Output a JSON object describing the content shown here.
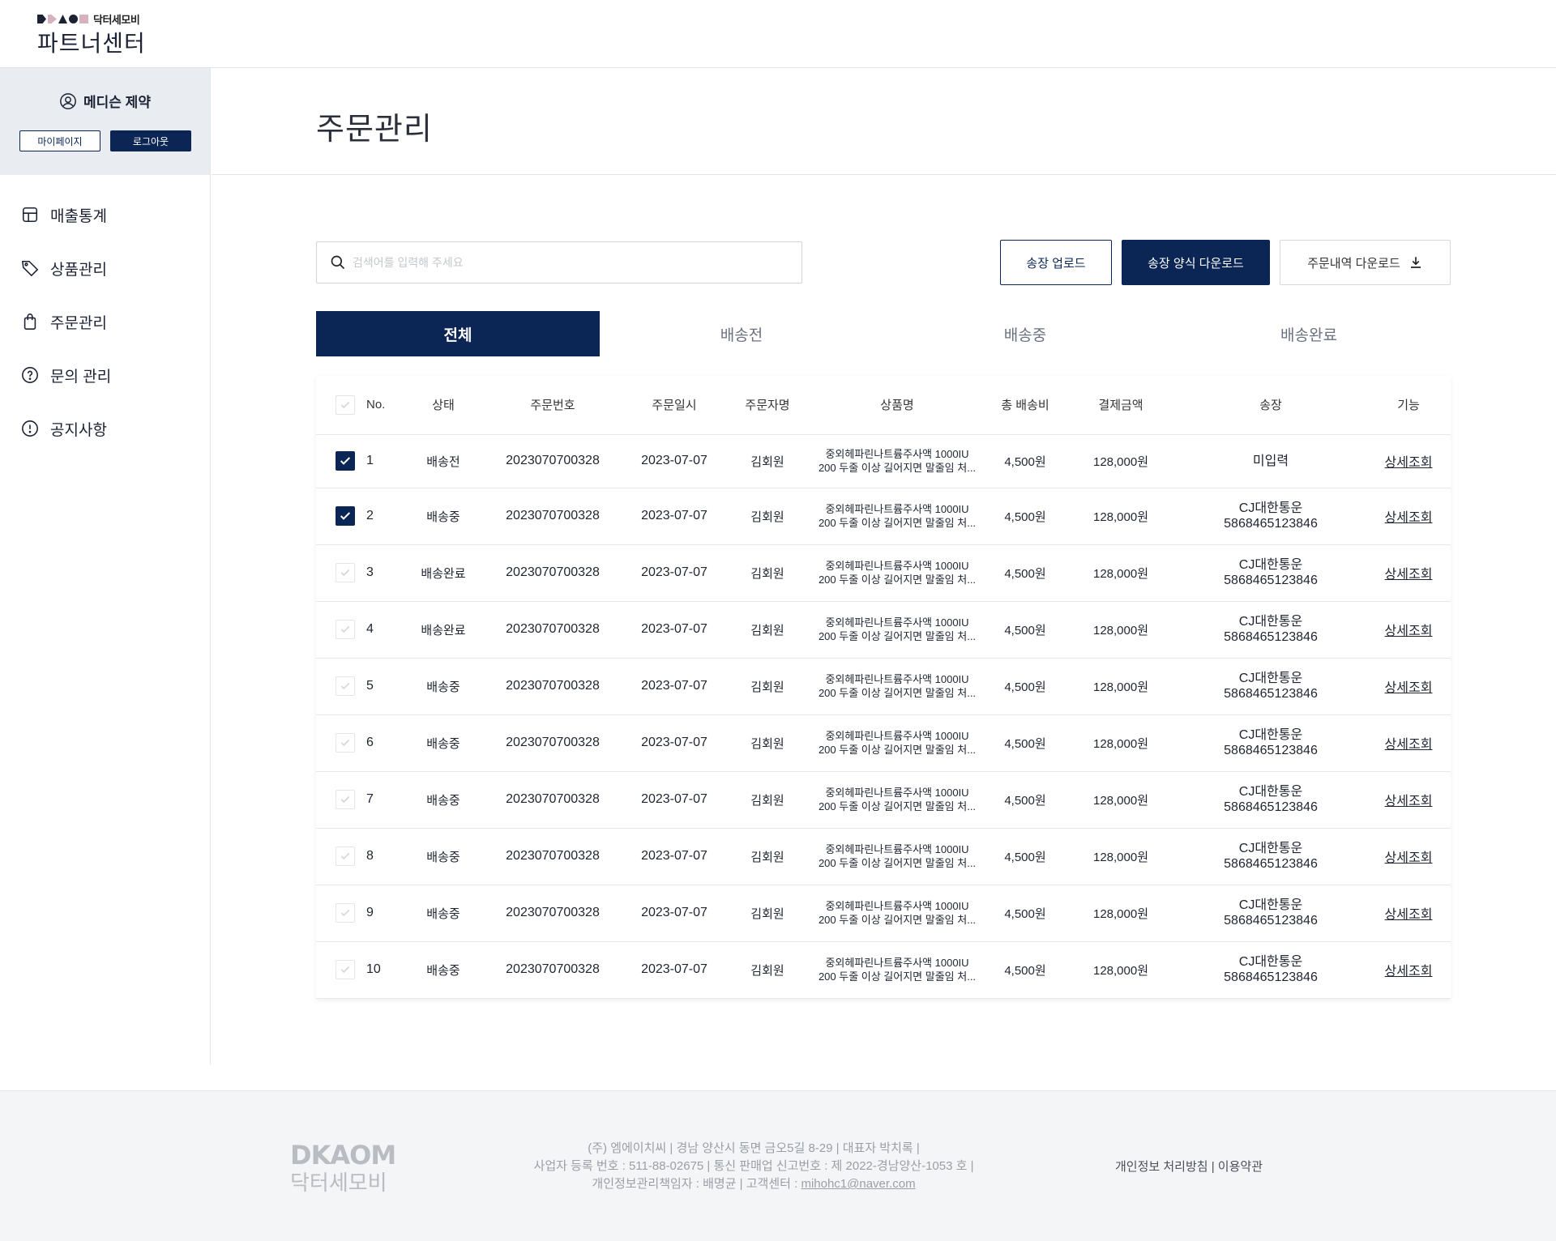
{
  "header": {
    "brand_text": "닥터세모비",
    "app_title": "파트너센터",
    "logo_marks_colors": [
      "#1c2233",
      "#d6b1c0",
      "#1c2233",
      "#d6b1c0"
    ]
  },
  "sidebar": {
    "user_name": "메디슨 제약",
    "mypage_label": "마이페이지",
    "logout_label": "로그아웃",
    "items": [
      {
        "label": "매출통계",
        "icon": "chart-icon"
      },
      {
        "label": "상품관리",
        "icon": "tag-icon"
      },
      {
        "label": "주문관리",
        "icon": "shopping-bag-icon"
      },
      {
        "label": "문의 관리",
        "icon": "question-icon"
      },
      {
        "label": "공지사항",
        "icon": "alert-icon"
      }
    ]
  },
  "main": {
    "title": "주문관리",
    "search_placeholder": "검색어를 입력해 주세요",
    "buttons": {
      "upload": "송장 업로드",
      "template": "송장 양식 다운로드",
      "history": "주문내역 다운로드"
    },
    "tabs": [
      "전체",
      "배송전",
      "배송중",
      "배송완료"
    ],
    "active_tab": "전체"
  },
  "table": {
    "headers": [
      "No.",
      "상태",
      "주문번호",
      "주문일시",
      "주문자명",
      "상품명",
      "총 배송비",
      "결제금액",
      "송장",
      "기능"
    ],
    "rows": [
      {
        "no": "1",
        "checked": true,
        "status": "배송전",
        "order_no": "2023070700328",
        "date": "2023-07-07",
        "name": "김회원",
        "product_1": "중외헤파린나트륨주사액 1000IU",
        "product_2": "200 두줄 이상 길어지면 말줄임 처...",
        "shipping": "4,500원",
        "amount": "128,000원",
        "inv_1": "미입력",
        "inv_2": "",
        "action": "상세조회"
      },
      {
        "no": "2",
        "checked": true,
        "status": "배송중",
        "order_no": "2023070700328",
        "date": "2023-07-07",
        "name": "김회원",
        "product_1": "중외헤파린나트륨주사액 1000IU",
        "product_2": "200 두줄 이상 길어지면 말줄임 처...",
        "shipping": "4,500원",
        "amount": "128,000원",
        "inv_1": "CJ대한통운",
        "inv_2": "5868465123846",
        "action": "상세조회"
      },
      {
        "no": "3",
        "checked": false,
        "status": "배송완료",
        "order_no": "2023070700328",
        "date": "2023-07-07",
        "name": "김회원",
        "product_1": "중외헤파린나트륨주사액 1000IU",
        "product_2": "200 두줄 이상 길어지면 말줄임 처...",
        "shipping": "4,500원",
        "amount": "128,000원",
        "inv_1": "CJ대한통운",
        "inv_2": "5868465123846",
        "action": "상세조회"
      },
      {
        "no": "4",
        "checked": false,
        "status": "배송완료",
        "order_no": "2023070700328",
        "date": "2023-07-07",
        "name": "김회원",
        "product_1": "중외헤파린나트륨주사액 1000IU",
        "product_2": "200 두줄 이상 길어지면 말줄임 처...",
        "shipping": "4,500원",
        "amount": "128,000원",
        "inv_1": "CJ대한통운",
        "inv_2": "5868465123846",
        "action": "상세조회"
      },
      {
        "no": "5",
        "checked": false,
        "status": "배송중",
        "order_no": "2023070700328",
        "date": "2023-07-07",
        "name": "김회원",
        "product_1": "중외헤파린나트륨주사액 1000IU",
        "product_2": "200 두줄 이상 길어지면 말줄임 처...",
        "shipping": "4,500원",
        "amount": "128,000원",
        "inv_1": "CJ대한통운",
        "inv_2": "5868465123846",
        "action": "상세조회"
      },
      {
        "no": "6",
        "checked": false,
        "status": "배송중",
        "order_no": "2023070700328",
        "date": "2023-07-07",
        "name": "김회원",
        "product_1": "중외헤파린나트륨주사액 1000IU",
        "product_2": "200 두줄 이상 길어지면 말줄임 처...",
        "shipping": "4,500원",
        "amount": "128,000원",
        "inv_1": "CJ대한통운",
        "inv_2": "5868465123846",
        "action": "상세조회"
      },
      {
        "no": "7",
        "checked": false,
        "status": "배송중",
        "order_no": "2023070700328",
        "date": "2023-07-07",
        "name": "김회원",
        "product_1": "중외헤파린나트륨주사액 1000IU",
        "product_2": "200 두줄 이상 길어지면 말줄임 처...",
        "shipping": "4,500원",
        "amount": "128,000원",
        "inv_1": "CJ대한통운",
        "inv_2": "5868465123846",
        "action": "상세조회"
      },
      {
        "no": "8",
        "checked": false,
        "status": "배송중",
        "order_no": "2023070700328",
        "date": "2023-07-07",
        "name": "김회원",
        "product_1": "중외헤파린나트륨주사액 1000IU",
        "product_2": "200 두줄 이상 길어지면 말줄임 처...",
        "shipping": "4,500원",
        "amount": "128,000원",
        "inv_1": "CJ대한통운",
        "inv_2": "5868465123846",
        "action": "상세조회"
      },
      {
        "no": "9",
        "checked": false,
        "status": "배송중",
        "order_no": "2023070700328",
        "date": "2023-07-07",
        "name": "김회원",
        "product_1": "중외헤파린나트륨주사액 1000IU",
        "product_2": "200 두줄 이상 길어지면 말줄임 처...",
        "shipping": "4,500원",
        "amount": "128,000원",
        "inv_1": "CJ대한통운",
        "inv_2": "5868465123846",
        "action": "상세조회"
      },
      {
        "no": "10",
        "checked": false,
        "status": "배송중",
        "order_no": "2023070700328",
        "date": "2023-07-07",
        "name": "김회원",
        "product_1": "중외헤파린나트륨주사액 1000IU",
        "product_2": "200 두줄 이상 길어지면 말줄임 처...",
        "shipping": "4,500원",
        "amount": "128,000원",
        "inv_1": "CJ대한통운",
        "inv_2": "5868465123846",
        "action": "상세조회"
      }
    ]
  },
  "footer": {
    "logo_text": "DKAOM",
    "brand_text": "닥터세모비",
    "line1": "(주) 엠에이치씨 | 경남 양산시 동면 금오5길 8-29 | 대표자 박치록 |",
    "line2": "사업자 등록 번호 : 511-88-02675 | 통신 판매업 신고번호 : 제 2022-경남양산-1053 호 |",
    "line3_prefix": "개인정보관리책임자 : 배명균 | 고객센터 : ",
    "email": "mihohc1@naver.com",
    "links": "개인정보 처리방침 | 이용약관"
  },
  "colors": {
    "primary": "#0b2555",
    "sidebar_panel": "#e9edf2",
    "footer_bg": "#f4f5f7"
  }
}
